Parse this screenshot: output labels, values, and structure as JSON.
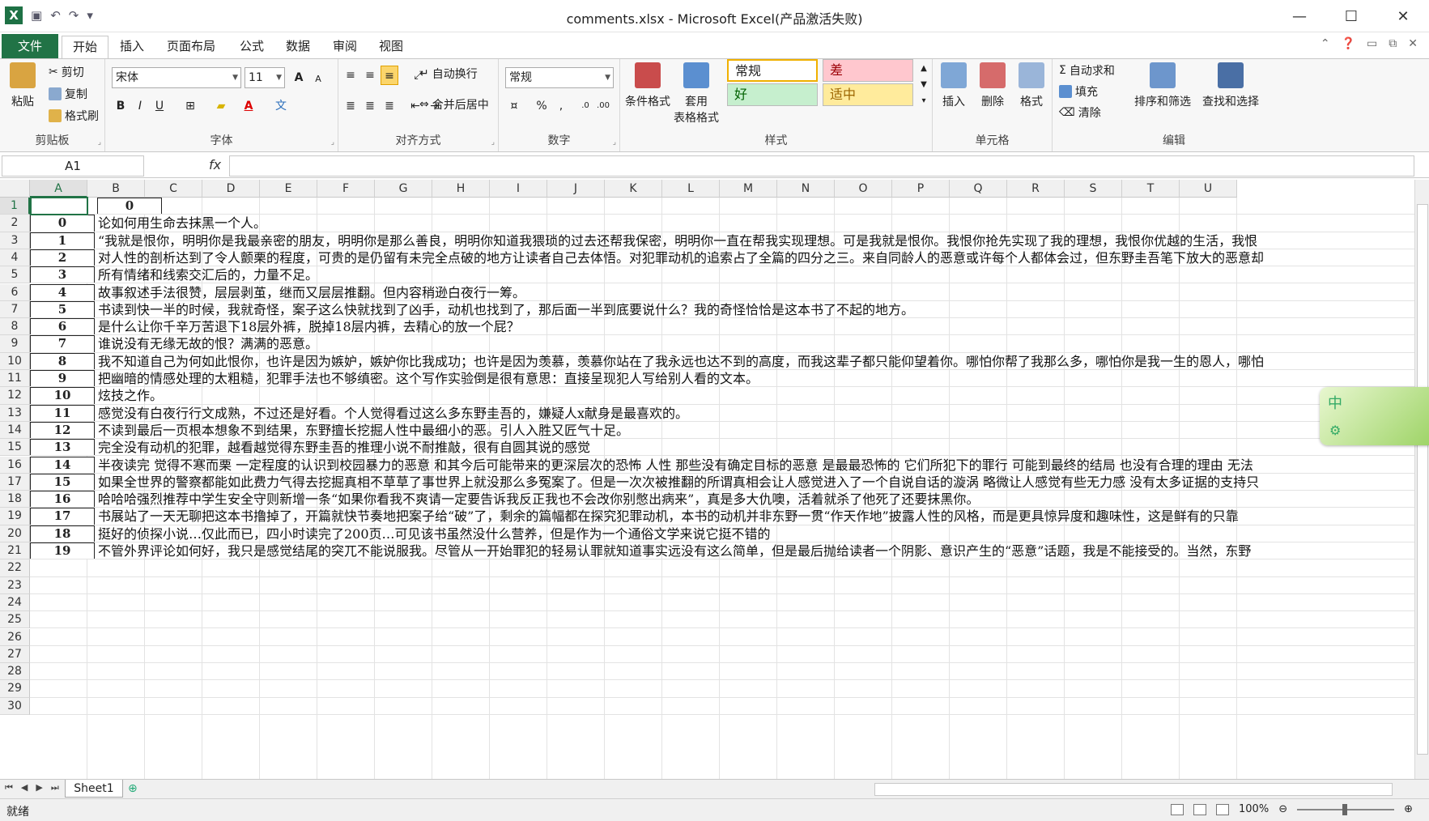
{
  "window": {
    "title": "comments.xlsx - Microsoft Excel(产品激活失败)",
    "minimize": "—",
    "maximize": "☐",
    "close": "✕"
  },
  "qat": {
    "logo": "X"
  },
  "tabs": {
    "file": "文件",
    "home": "开始",
    "insert": "插入",
    "layout": "页面布局",
    "formulas": "公式",
    "data": "数据",
    "review": "审阅",
    "view": "视图"
  },
  "clipboard": {
    "paste": "粘贴",
    "cut": "剪切",
    "copy": "复制",
    "format_painter": "格式刷",
    "label": "剪贴板"
  },
  "font": {
    "name": "宋体",
    "size": "11",
    "bold": "B",
    "italic": "I",
    "underline": "U",
    "label": "字体",
    "grow": "A",
    "shrink": "A"
  },
  "alignment": {
    "wrap": "自动换行",
    "merge": "合并后居中",
    "label": "对齐方式"
  },
  "number": {
    "format": "常规",
    "percent": "%",
    "comma": ",",
    "label": "数字"
  },
  "styles": {
    "conditional": "条件格式",
    "table_line1": "套用",
    "table_line2": "表格格式",
    "normal": "常规",
    "bad": "差",
    "good": "好",
    "neutral": "适中",
    "label": "样式"
  },
  "cells": {
    "insert": "插入",
    "delete": "删除",
    "format": "格式",
    "label": "单元格"
  },
  "editing": {
    "autosum": "自动求和",
    "fill": "填充",
    "clear": "清除",
    "sort": "排序和筛选",
    "find": "查找和选择",
    "label": "编辑"
  },
  "formula_bar": {
    "name_box": "A1",
    "fx": "fx",
    "value": ""
  },
  "columns": [
    "A",
    "B",
    "C",
    "D",
    "E",
    "F",
    "G",
    "H",
    "I",
    "J",
    "K",
    "L",
    "M",
    "N",
    "O",
    "P",
    "Q",
    "R",
    "S",
    "T",
    "U"
  ],
  "row_numbers": [
    "1",
    "2",
    "3",
    "4",
    "5",
    "6",
    "7",
    "8",
    "9",
    "10",
    "11",
    "12",
    "13",
    "14",
    "15",
    "16",
    "17",
    "18",
    "19",
    "20",
    "21",
    "22",
    "23",
    "24",
    "25",
    "26",
    "27",
    "28",
    "29",
    "30"
  ],
  "header_b1": "0",
  "rows": [
    {
      "a": "0",
      "b": "论如何用生命去抹黑一个人。"
    },
    {
      "a": "1",
      "b": "“我就是恨你，明明你是我最亲密的朋友，明明你是那么善良，明明你知道我猥琐的过去还帮我保密，明明你一直在帮我实现理想。可是我就是恨你。我恨你抢先实现了我的理想，我恨你优越的生活，我恨"
    },
    {
      "a": "2",
      "b": "对人性的剖析达到了令人颤栗的程度，可贵的是仍留有未完全点破的地方让读者自己去体悟。对犯罪动机的追索占了全篇的四分之三。来自同龄人的恶意或许每个人都体会过，但东野圭吾笔下放大的恶意却"
    },
    {
      "a": "3",
      "b": "所有情绪和线索交汇后的，力量不足。"
    },
    {
      "a": "4",
      "b": "故事叙述手法很赞，层层剥茧，继而又层层推翻。但内容稍逊白夜行一筹。"
    },
    {
      "a": "5",
      "b": "书读到快一半的时候，我就奇怪，案子这么快就找到了凶手，动机也找到了，那后面一半到底要说什么？我的奇怪恰恰是这本书了不起的地方。"
    },
    {
      "a": "6",
      "b": "是什么让你千辛万苦退下18层外裤，脱掉18层内裤，去精心的放一个屁？"
    },
    {
      "a": "7",
      "b": "谁说没有无缘无故的恨？满满的恶意。"
    },
    {
      "a": "8",
      "b": "我不知道自己为何如此恨你，也许是因为嫉妒，嫉妒你比我成功；也许是因为羡慕，羡慕你站在了我永远也达不到的高度，而我这辈子都只能仰望着你。哪怕你帮了我那么多，哪怕你是我一生的恩人，哪怕"
    },
    {
      "a": "9",
      "b": "把幽暗的情感处理的太粗糙，犯罪手法也不够缜密。这个写作实验倒是很有意思：直接呈现犯人写给别人看的文本。"
    },
    {
      "a": "10",
      "b": "炫技之作。"
    },
    {
      "a": "11",
      "b": "感觉没有白夜行行文成熟，不过还是好看。个人觉得看过这么多东野圭吾的，嫌疑人x献身是最喜欢的。"
    },
    {
      "a": "12",
      "b": " 不读到最后一页根本想象不到结果，东野擅长挖掘人性中最细小的恶。引人入胜又匠气十足。"
    },
    {
      "a": "13",
      "b": "完全没有动机的犯罪，越看越觉得东野圭吾的推理小说不耐推敲，很有自圆其说的感觉"
    },
    {
      "a": "14",
      "b": "半夜读完 觉得不寒而栗 一定程度的认识到校园暴力的恶意 和其今后可能带来的更深层次的恐怖 人性 那些没有确定目标的恶意 是最最恐怖的 它们所犯下的罪行 可能到最终的结局 也没有合理的理由 无法"
    },
    {
      "a": "15",
      "b": "如果全世界的警察都能如此费力气得去挖掘真相不草草了事世界上就没那么多冤案了。但是一次次被推翻的所谓真相会让人感觉进入了一个自说自话的漩涡 略微让人感觉有些无力感 没有太多证据的支持只"
    },
    {
      "a": "16",
      "b": "哈哈哈强烈推荐中学生安全守则新增一条“如果你看我不爽请一定要告诉我反正我也不会改你别憋出病来”，真是多大仇噢，活着就杀了他死了还要抹黑你。"
    },
    {
      "a": "17",
      "b": "书展站了一天无聊把这本书撸掉了，开篇就快节奏地把案子给“破”了，剩余的篇幅都在探究犯罪动机，本书的动机并非东野一贯“作天作地”披露人性的风格，而是更具惊异度和趣味性，这是鲜有的只靠"
    },
    {
      "a": "18",
      "b": "挺好的侦探小说…仅此而已，四小时读完了200页…可见该书虽然没什么营养，但是作为一个通俗文学来说它挺不错的"
    },
    {
      "a": "19",
      "b": "不管外界评论如何好，我只是感觉结尾的突兀不能说服我。尽管从一开始罪犯的轻易认罪就知道事实远没有这么简单，但是最后抛给读者一个阴影、意识产生的“恶意”话题，我是不能接受的。当然，东野"
    }
  ],
  "sheet": {
    "tab": "Sheet1"
  },
  "status": {
    "ready": "就绪",
    "zoom": "100%"
  },
  "ime": {
    "label": "中"
  }
}
